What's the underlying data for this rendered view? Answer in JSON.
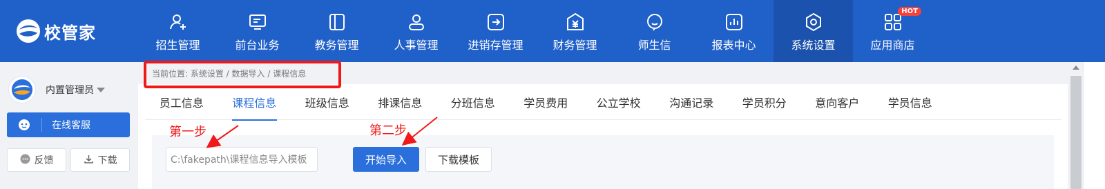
{
  "app": {
    "logo_text": "校管家"
  },
  "nav": {
    "items": [
      {
        "label": "招生管理",
        "icon": "user-add-icon"
      },
      {
        "label": "前台业务",
        "icon": "monitor-icon"
      },
      {
        "label": "教务管理",
        "icon": "book-icon"
      },
      {
        "label": "人事管理",
        "icon": "person-icon"
      },
      {
        "label": "进销存管理",
        "icon": "inout-icon"
      },
      {
        "label": "财务管理",
        "icon": "yuan-icon"
      },
      {
        "label": "师生信",
        "icon": "chat-icon"
      },
      {
        "label": "报表中心",
        "icon": "report-icon"
      },
      {
        "label": "系统设置",
        "icon": "settings-icon",
        "active": true
      },
      {
        "label": "应用商店",
        "icon": "apps-icon",
        "badge": "HOT"
      }
    ]
  },
  "sidebar": {
    "user_name": "内置管理员",
    "online_service": "在线客服",
    "feedback": "反馈",
    "download": "下载"
  },
  "breadcrumb": {
    "text": "当前位置:  系统设置 / 数据导入 / 课程信息"
  },
  "tabs": [
    {
      "label": "员工信息"
    },
    {
      "label": "课程信息",
      "active": true
    },
    {
      "label": "班级信息"
    },
    {
      "label": "排课信息"
    },
    {
      "label": "分班信息"
    },
    {
      "label": "学员费用"
    },
    {
      "label": "公立学校"
    },
    {
      "label": "沟通记录"
    },
    {
      "label": "学员积分"
    },
    {
      "label": "意向客户"
    },
    {
      "label": "学员信息"
    }
  ],
  "import": {
    "file_value": "C:\\fakepath\\课程信息导入模板",
    "start_button": "开始导入",
    "template_button": "下载模板"
  },
  "annotations": {
    "step1": "第一步",
    "step2": "第二步"
  },
  "colors": {
    "nav_bg": "#2060c9",
    "primary": "#2a6fdb",
    "annotation_red": "#f01818"
  }
}
